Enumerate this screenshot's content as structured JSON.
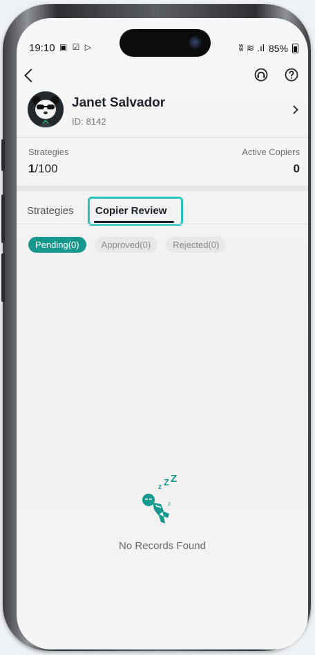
{
  "status_bar": {
    "time": "19:10",
    "left_icons": "▣ ☑ ▷",
    "right_icons": "ʬ ≋ .ıl",
    "battery": "85%"
  },
  "nav": {
    "back_icon": "chevron-left",
    "support_icon": "headset",
    "help_icon": "question-circle"
  },
  "profile": {
    "name": "Janet Salvador",
    "id_label": "ID:",
    "id_value": "8142"
  },
  "stats": {
    "strategies_label": "Strategies",
    "strategies_used": "1",
    "strategies_total": "/100",
    "copiers_label": "Active Copiers",
    "copiers_value": "0"
  },
  "tabs": {
    "strategies": "Strategies",
    "copier_review": "Copier Review"
  },
  "filters": {
    "pending": "Pending(0)",
    "approved": "Approved(0)",
    "rejected": "Rejected(0)"
  },
  "empty_state": {
    "message": "No Records Found",
    "sleep_text": "zZZ"
  },
  "colors": {
    "accent": "#16998c",
    "highlight": "#25c1bc",
    "text_dark": "#1f2330"
  }
}
